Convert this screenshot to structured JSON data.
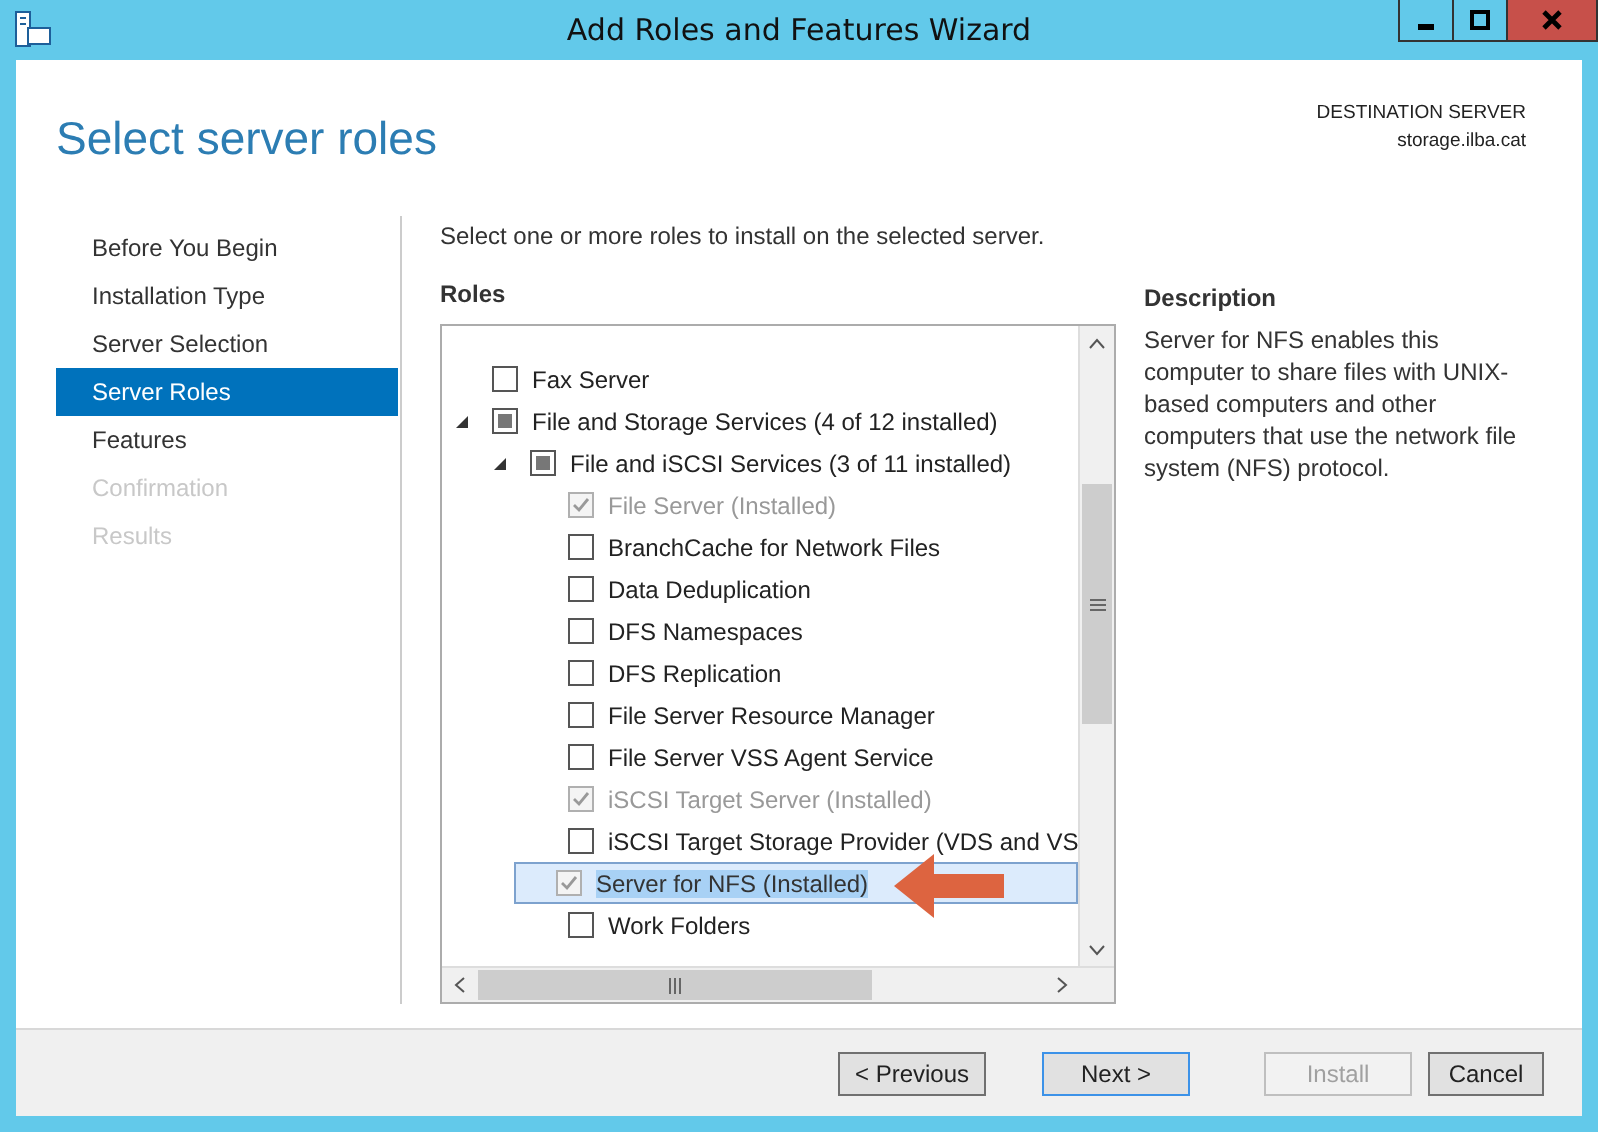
{
  "window": {
    "title": "Add Roles and Features Wizard"
  },
  "header": {
    "title": "Select server roles",
    "destination_label": "DESTINATION SERVER",
    "destination_server": "storage.ilba.cat"
  },
  "sidebar": {
    "items": [
      {
        "label": "Before You Begin",
        "selected": false,
        "disabled": false
      },
      {
        "label": "Installation Type",
        "selected": false,
        "disabled": false
      },
      {
        "label": "Server Selection",
        "selected": false,
        "disabled": false
      },
      {
        "label": "Server Roles",
        "selected": true,
        "disabled": false
      },
      {
        "label": "Features",
        "selected": false,
        "disabled": false
      },
      {
        "label": "Confirmation",
        "selected": false,
        "disabled": true
      },
      {
        "label": "Results",
        "selected": false,
        "disabled": true
      }
    ]
  },
  "instruction": "Select one or more roles to install on the selected server.",
  "roles": {
    "heading": "Roles",
    "items": [
      {
        "label": "Fax Server",
        "checked": false,
        "partial": false,
        "disabled": false,
        "selected": false
      },
      {
        "label": "File and Storage Services (4 of 12 installed)",
        "checked": false,
        "partial": true,
        "disabled": false,
        "selected": false,
        "expanded": true,
        "children": [
          {
            "label": "File and iSCSI Services (3 of 11 installed)",
            "checked": false,
            "partial": true,
            "disabled": false,
            "selected": false,
            "expanded": true,
            "children": [
              {
                "label": "File Server (Installed)",
                "checked": true,
                "partial": false,
                "disabled": true,
                "selected": false
              },
              {
                "label": "BranchCache for Network Files",
                "checked": false,
                "partial": false,
                "disabled": false,
                "selected": false
              },
              {
                "label": "Data Deduplication",
                "checked": false,
                "partial": false,
                "disabled": false,
                "selected": false
              },
              {
                "label": "DFS Namespaces",
                "checked": false,
                "partial": false,
                "disabled": false,
                "selected": false
              },
              {
                "label": "DFS Replication",
                "checked": false,
                "partial": false,
                "disabled": false,
                "selected": false
              },
              {
                "label": "File Server Resource Manager",
                "checked": false,
                "partial": false,
                "disabled": false,
                "selected": false
              },
              {
                "label": "File Server VSS Agent Service",
                "checked": false,
                "partial": false,
                "disabled": false,
                "selected": false
              },
              {
                "label": "iSCSI Target Server (Installed)",
                "checked": true,
                "partial": false,
                "disabled": true,
                "selected": false
              },
              {
                "label": "iSCSI Target Storage Provider (VDS and VS",
                "checked": false,
                "partial": false,
                "disabled": false,
                "selected": false
              },
              {
                "label": "Server for NFS (Installed)",
                "checked": true,
                "partial": false,
                "disabled": true,
                "selected": true
              },
              {
                "label": "Work Folders",
                "checked": false,
                "partial": false,
                "disabled": false,
                "selected": false
              }
            ]
          }
        ]
      }
    ]
  },
  "description": {
    "heading": "Description",
    "text": "Server for NFS enables this computer to share files with UNIX-based computers and other computers that use the network file system (NFS) protocol."
  },
  "buttons": [
    {
      "label": "< Previous",
      "disabled": false,
      "default": false
    },
    {
      "label": "Next >",
      "disabled": false,
      "default": true
    },
    {
      "label": "Install",
      "disabled": true,
      "default": false
    },
    {
      "label": "Cancel",
      "disabled": false,
      "default": false
    }
  ]
}
